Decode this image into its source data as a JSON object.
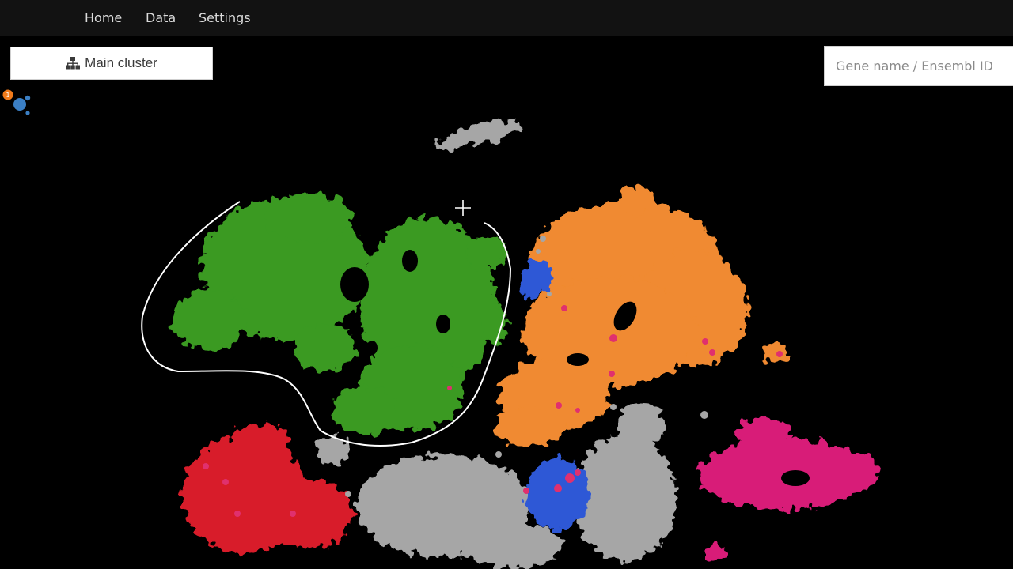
{
  "nav": {
    "items": [
      {
        "label": "Home"
      },
      {
        "label": "Data"
      },
      {
        "label": "Settings"
      }
    ]
  },
  "toolbar": {
    "cluster_button_label": "Main cluster",
    "cluster_button_icon": "sitemap-icon"
  },
  "search": {
    "placeholder": "Gene name / Ensembl ID",
    "value": ""
  },
  "status": {
    "badge_count": "1"
  },
  "colors": {
    "background": "#000000",
    "navbar": "#121212",
    "cluster_green": "#3a9a22",
    "cluster_orange": "#f08a30",
    "cluster_gray": "#a6a6a6",
    "cluster_red": "#d81e2a",
    "cluster_pink": "#d81e78",
    "cluster_blue": "#2f58d6",
    "lasso": "#ffffff"
  }
}
